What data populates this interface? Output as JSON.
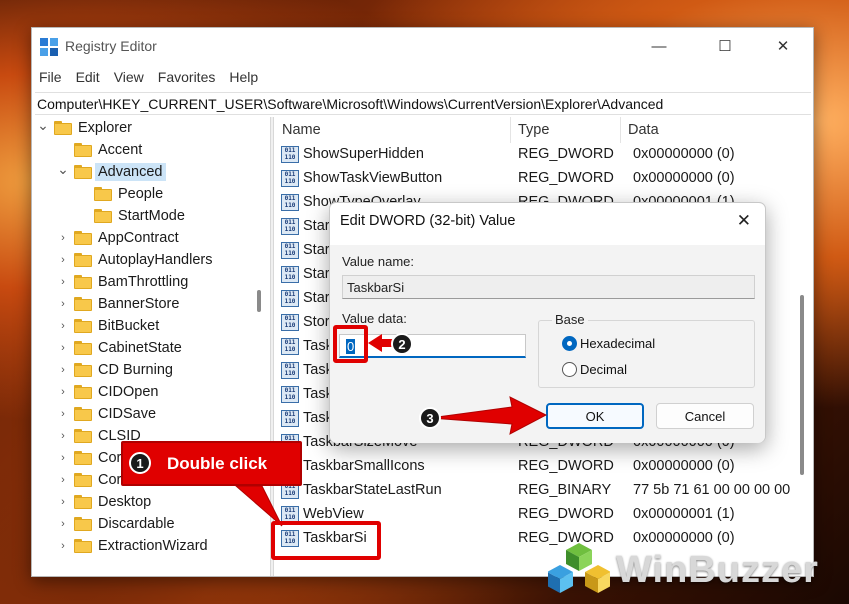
{
  "window": {
    "title": "Registry Editor",
    "controls": {
      "minimize": "—",
      "maximize": "☐",
      "close": "✕"
    }
  },
  "menu": [
    "File",
    "Edit",
    "View",
    "Favorites",
    "Help"
  ],
  "address": "Computer\\HKEY_CURRENT_USER\\Software\\Microsoft\\Windows\\CurrentVersion\\Explorer\\Advanced",
  "tree": [
    {
      "label": "Explorer",
      "level": 0,
      "expanded": true
    },
    {
      "label": "Accent",
      "level": 1
    },
    {
      "label": "Advanced",
      "level": 1,
      "expanded": true,
      "selected": true
    },
    {
      "label": "People",
      "level": 2
    },
    {
      "label": "StartMode",
      "level": 2
    },
    {
      "label": "AppContract",
      "level": 1,
      "collapsed": true
    },
    {
      "label": "AutoplayHandlers",
      "level": 1,
      "collapsed": true
    },
    {
      "label": "BamThrottling",
      "level": 1,
      "collapsed": true
    },
    {
      "label": "BannerStore",
      "level": 1,
      "collapsed": true
    },
    {
      "label": "BitBucket",
      "level": 1,
      "collapsed": true
    },
    {
      "label": "CabinetState",
      "level": 1,
      "collapsed": true
    },
    {
      "label": "CD Burning",
      "level": 1,
      "collapsed": true
    },
    {
      "label": "CIDOpen",
      "level": 1,
      "collapsed": true
    },
    {
      "label": "CIDSave",
      "level": 1,
      "collapsed": true
    },
    {
      "label": "CLSID",
      "level": 1,
      "collapsed": true
    },
    {
      "label": "Cor",
      "level": 1,
      "collapsed": true
    },
    {
      "label": "Cor",
      "level": 1,
      "collapsed": true
    },
    {
      "label": "Desktop",
      "level": 1,
      "collapsed": true
    },
    {
      "label": "Discardable",
      "level": 1,
      "collapsed": true
    },
    {
      "label": "ExtractionWizard",
      "level": 1,
      "collapsed": true
    }
  ],
  "columns": {
    "name": "Name",
    "type": "Type",
    "data": "Data"
  },
  "values": [
    {
      "name": "ShowSuperHidden",
      "type": "REG_DWORD",
      "data": "0x00000000 (0)"
    },
    {
      "name": "ShowTaskViewButton",
      "type": "REG_DWORD",
      "data": "0x00000000 (0)"
    },
    {
      "name": "ShowTypeOverlay",
      "type": "REG_DWORD",
      "data": "0x00000001 (1)"
    },
    {
      "name": "Star",
      "type": "",
      "data": ""
    },
    {
      "name": "Star",
      "type": "",
      "data": ""
    },
    {
      "name": "Star",
      "type": "",
      "data": ""
    },
    {
      "name": "Star",
      "type": "",
      "data": ""
    },
    {
      "name": "Stor",
      "type": "",
      "data": ""
    },
    {
      "name": "Task",
      "type": "",
      "data": ""
    },
    {
      "name": "Task",
      "type": "",
      "data": ""
    },
    {
      "name": "Task",
      "type": "",
      "data": ""
    },
    {
      "name": "Task",
      "type": "",
      "data": ""
    },
    {
      "name": "TaskbarSizeMove",
      "type": "REG_DWORD",
      "data": "0x00000000 (0)"
    },
    {
      "name": "TaskbarSmallIcons",
      "type": "REG_DWORD",
      "data": "0x00000000 (0)"
    },
    {
      "name": "TaskbarStateLastRun",
      "type": "REG_BINARY",
      "data": "77 5b 71 61 00 00 00 00"
    },
    {
      "name": "WebView",
      "type": "REG_DWORD",
      "data": "0x00000001 (1)"
    },
    {
      "name": "TaskbarSi",
      "type": "REG_DWORD",
      "data": "0x00000000 (0)"
    }
  ],
  "dialog": {
    "title": "Edit DWORD (32-bit) Value",
    "close": "✕",
    "value_name_label": "Value name:",
    "value_name": "TaskbarSi",
    "value_data_label": "Value data:",
    "value_data": "0",
    "base_label": "Base",
    "hex_label": "Hexadecimal",
    "dec_label": "Decimal",
    "base_selected": "Hexadecimal",
    "ok": "OK",
    "cancel": "Cancel"
  },
  "annotations": {
    "step1": "1",
    "step1_text": "Double click",
    "step2": "2",
    "step3": "3",
    "color": "#e00000"
  },
  "watermark": "WinBuzzer"
}
